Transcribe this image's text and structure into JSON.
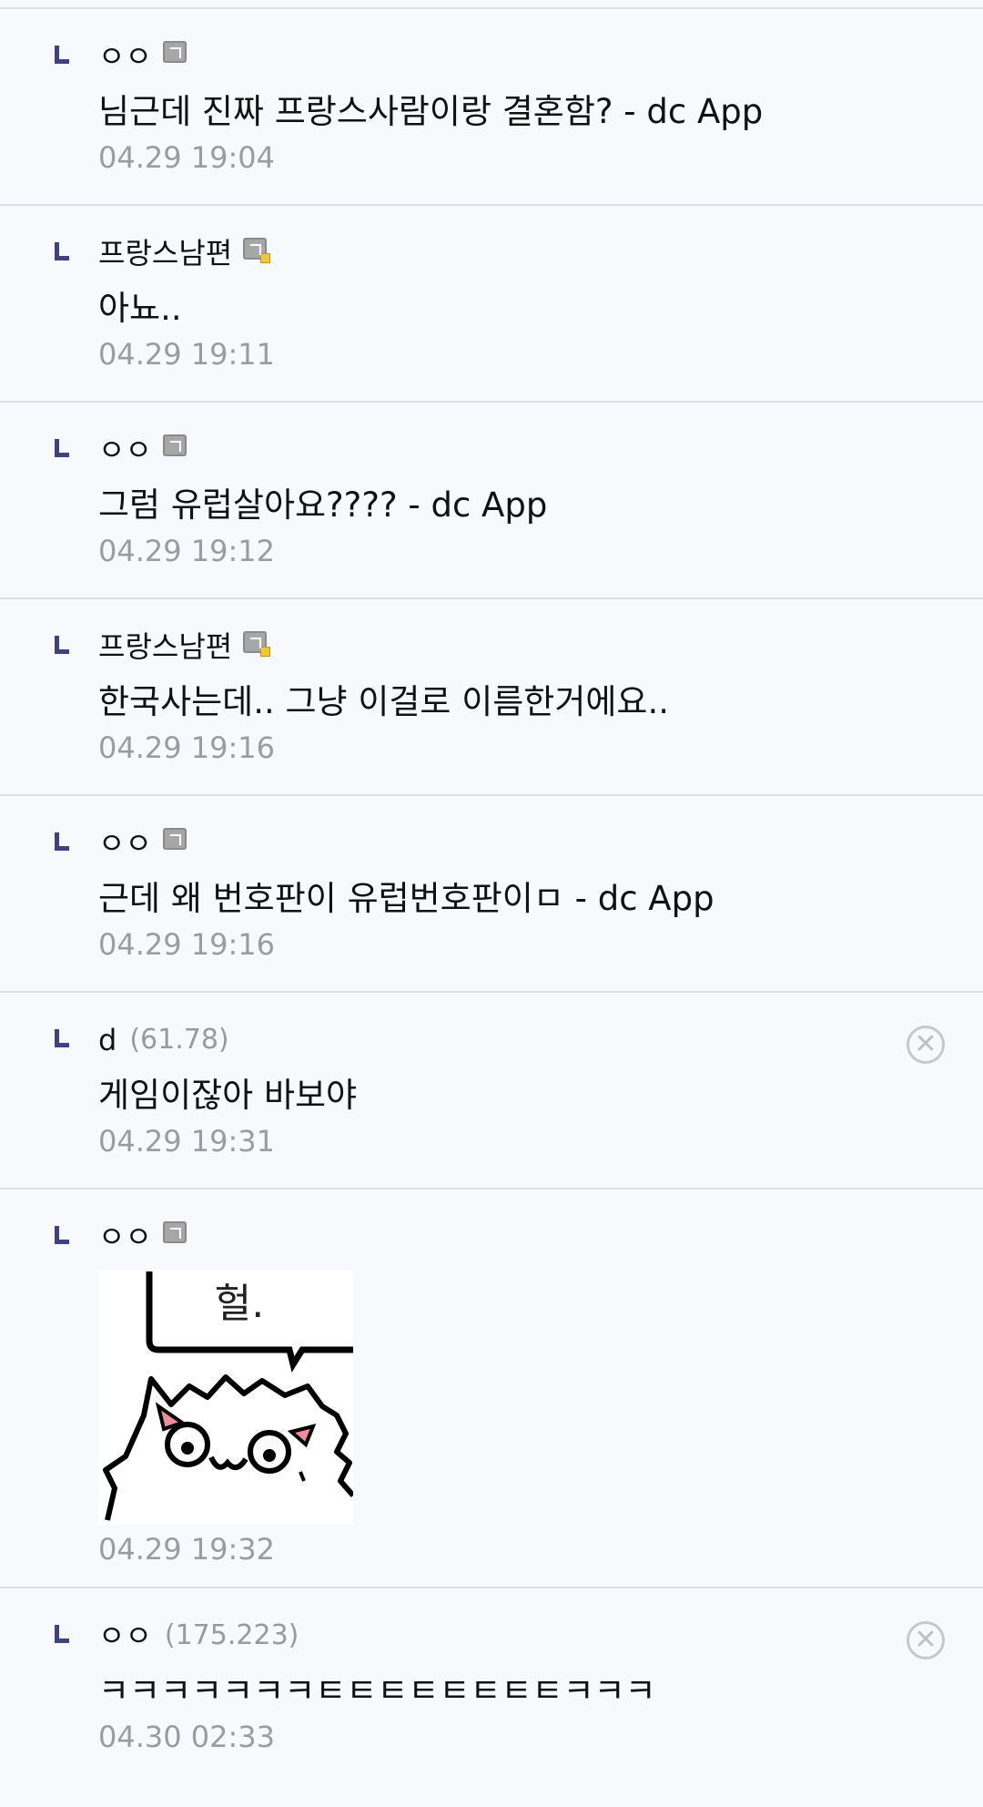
{
  "comments": [
    {
      "nick": "ㅇㅇ",
      "text": "님근데 진짜 프랑스사람이랑 결혼함? - dc App",
      "date": "04.29 19:04"
    },
    {
      "nick": "프랑스남편",
      "text": "아뇨..",
      "date": "04.29 19:11"
    },
    {
      "nick": "ㅇㅇ",
      "text": "그럼 유럽살아요???? - dc App",
      "date": "04.29 19:12"
    },
    {
      "nick": "프랑스남편",
      "text": "한국사는데.. 그냥 이걸로 이름한거에요..",
      "date": "04.29 19:16"
    },
    {
      "nick": "ㅇㅇ",
      "text": "근데 왜 번호판이 유럽번호판이ㅁ - dc App",
      "date": "04.29 19:16"
    },
    {
      "nick": "d",
      "ip": "(61.78)",
      "text": "게임이잖아 바보야",
      "date": "04.29 19:31"
    },
    {
      "nick": "ㅇㅇ",
      "sticker_text": "헐.",
      "date": "04.29 19:32"
    },
    {
      "nick": "ㅇㅇ",
      "ip": "(175.223)",
      "text": "ㅋㅋㅋㅋㅋㅋㅋㅌㅌㅌㅌㅌㅌㅌㅌㅋㅋㅋ",
      "date": "04.30 02:33"
    }
  ],
  "icons": {
    "reply": "reply-arrow-icon",
    "badge": "gallog-badge-icon",
    "badge_fixed": "fixed-nick-badge-icon",
    "delete": "delete-circle-x-icon"
  },
  "colors": {
    "background": "#f8f9fc",
    "divider": "#dde0ea",
    "reply_mark": "#3e4380",
    "date": "#9b9ba3"
  }
}
